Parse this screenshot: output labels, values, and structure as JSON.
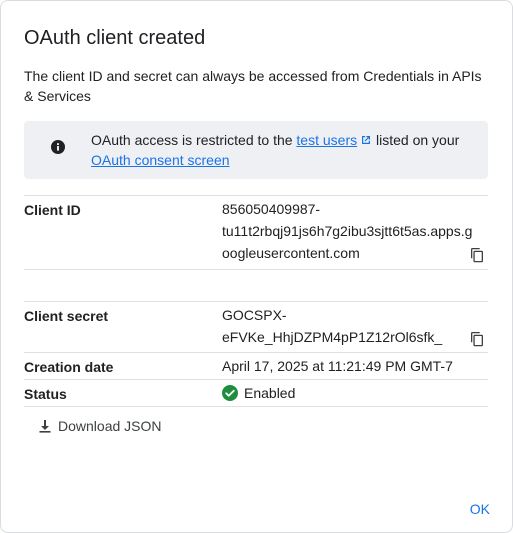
{
  "dialog": {
    "title": "OAuth client created",
    "description": "The client ID and secret can always be accessed from Credentials in APIs & Services"
  },
  "notice": {
    "icon": "info-icon",
    "text_before": "OAuth access is restricted to the ",
    "link1": "test users",
    "text_middle": " listed on your ",
    "link2": "OAuth consent screen"
  },
  "fields": {
    "client_id": {
      "label": "Client ID",
      "line1": "856050409987-",
      "line2": "tu11t2rbqj91js6h7g2ibu3sjtt6t5as.apps.g",
      "line3": "oogleusercontent.com"
    },
    "client_secret": {
      "label": "Client secret",
      "line1": "GOCSPX-",
      "line2": "eFVKe_HhjDZPM4pP1Z12rOl6sfk_"
    },
    "creation_date": {
      "label": "Creation date",
      "value": "April 17, 2025 at 11:21:49 PM GMT-7"
    },
    "status": {
      "label": "Status",
      "value": "Enabled",
      "color": "#1e8e3e"
    }
  },
  "actions": {
    "download_label": "Download JSON",
    "ok_label": "OK"
  },
  "colors": {
    "accent": "#1a73e8",
    "notice_bg": "#eef0f4",
    "success": "#1e8e3e"
  }
}
